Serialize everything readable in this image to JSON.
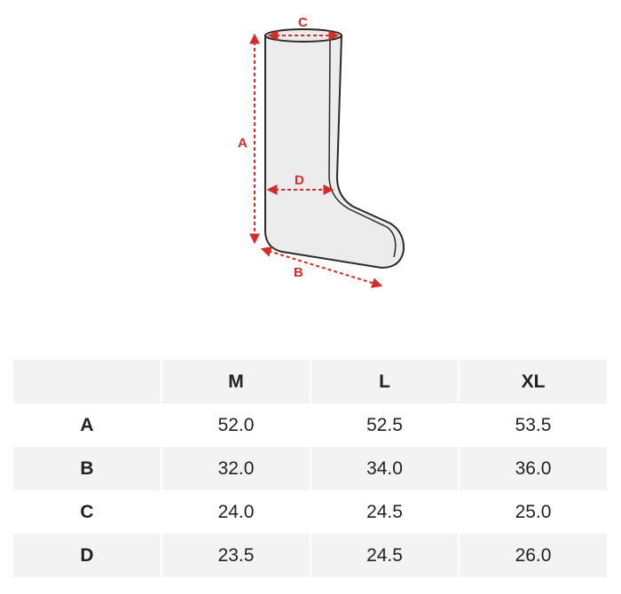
{
  "diagram": {
    "labels": {
      "a": "A",
      "b": "B",
      "c": "C",
      "d": "D"
    },
    "colors": {
      "outline": "#2a2a2a",
      "fill": "#ececec",
      "measure": "#d42b2b"
    }
  },
  "size_table": {
    "headers": [
      "",
      "M",
      "L",
      "XL"
    ],
    "rows": [
      {
        "label": "A",
        "values": [
          "52.0",
          "52.5",
          "53.5"
        ]
      },
      {
        "label": "B",
        "values": [
          "32.0",
          "34.0",
          "36.0"
        ]
      },
      {
        "label": "C",
        "values": [
          "24.0",
          "24.5",
          "25.0"
        ]
      },
      {
        "label": "D",
        "values": [
          "23.5",
          "24.5",
          "26.0"
        ]
      }
    ],
    "colors": {
      "shade": "#f3f3f3",
      "text": "#222222"
    }
  }
}
